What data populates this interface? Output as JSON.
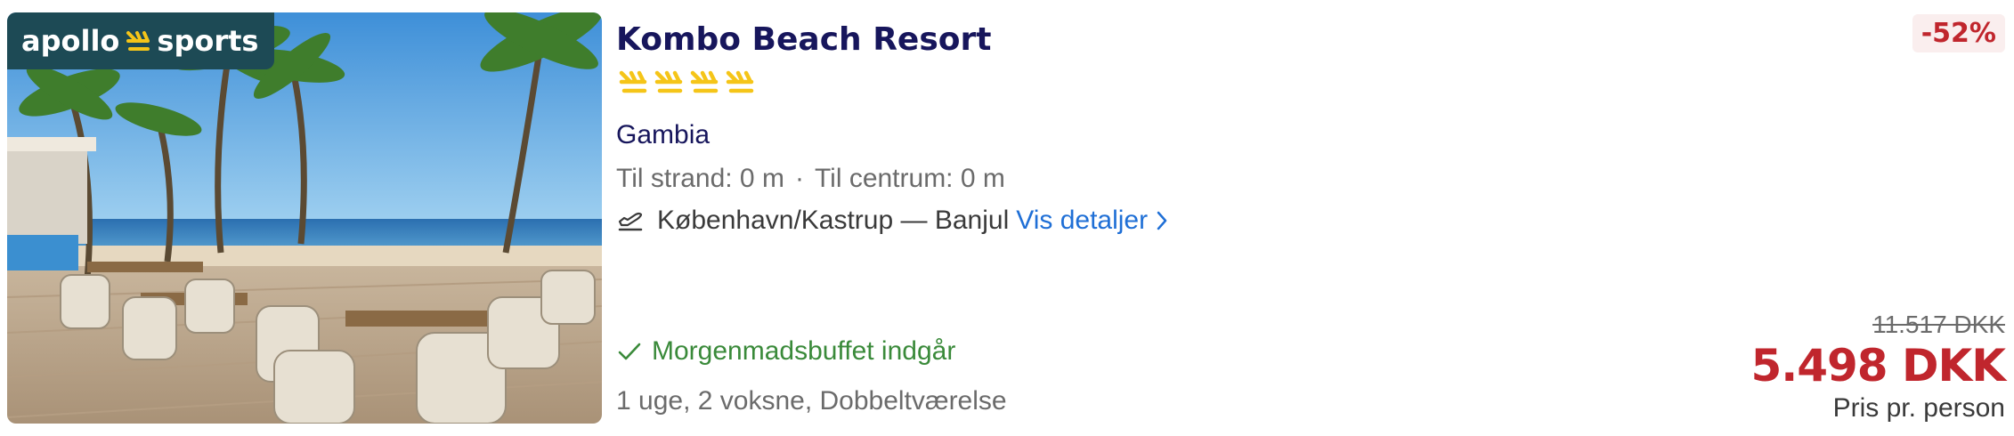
{
  "brand": {
    "name": "apollo",
    "sub": "sports"
  },
  "hotel": {
    "name": "Kombo Beach Resort",
    "rating": 4,
    "rating_icon": "apollo-palm-icon",
    "country": "Gambia",
    "distance_beach": "Til strand: 0 m",
    "separator": "·",
    "distance_center": "Til centrum: 0 m",
    "route": "København/Kastrup — Banjul",
    "details_link": "Vis detaljer",
    "board": "Morgenmadsbuffet indgår",
    "travel_info": "1 uge, 2 voksne, Dobbeltværelse"
  },
  "price": {
    "discount": "-52%",
    "old": "11.517 DKK",
    "new": "5.498 DKK",
    "note": "Pris pr. person"
  },
  "colors": {
    "title": "#17165c",
    "link": "#1f6fd6",
    "price": "#c0262d",
    "included": "#3a8a3a",
    "star": "#f5c518",
    "badge_bg": "#1d4a55"
  }
}
